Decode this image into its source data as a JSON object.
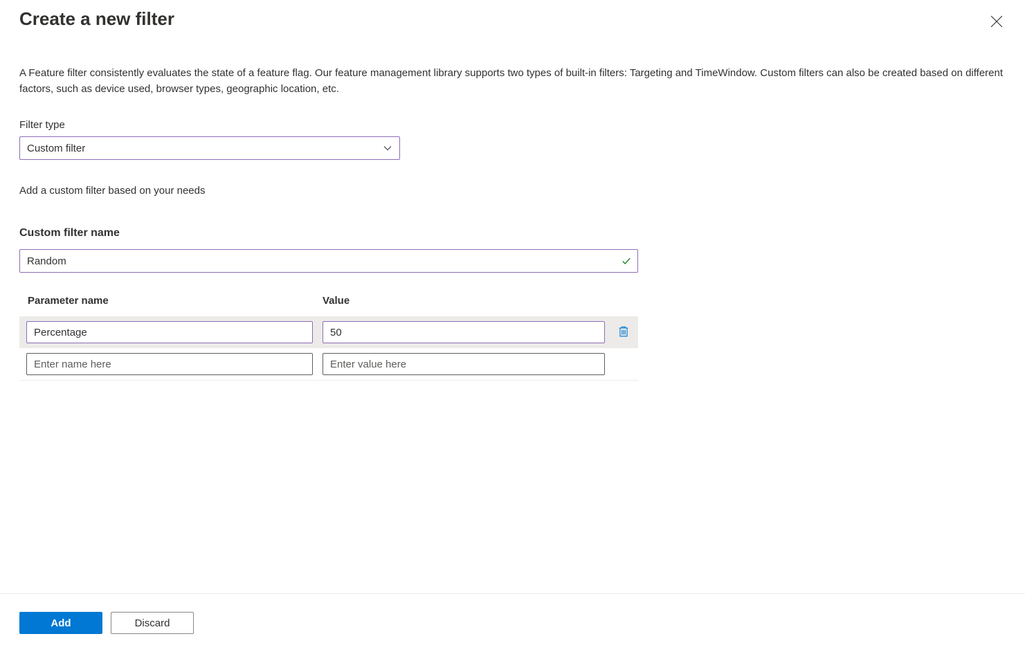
{
  "header": {
    "title": "Create a new filter"
  },
  "description": "A Feature filter consistently evaluates the state of a feature flag. Our feature management library supports two types of built-in filters: Targeting and TimeWindow. Custom filters can also be created based on different factors, such as device used, browser types, geographic location, etc.",
  "filterType": {
    "label": "Filter type",
    "selected": "Custom filter"
  },
  "helpText": "Add a custom filter based on your needs",
  "customFilter": {
    "label": "Custom filter name",
    "value": "Random"
  },
  "params": {
    "headers": {
      "name": "Parameter name",
      "value": "Value"
    },
    "rows": [
      {
        "name": "Percentage",
        "value": "50",
        "active": true
      },
      {
        "name": "",
        "value": "",
        "active": false
      }
    ],
    "placeholders": {
      "name": "Enter name here",
      "value": "Enter value here"
    }
  },
  "footer": {
    "add": "Add",
    "discard": "Discard"
  }
}
